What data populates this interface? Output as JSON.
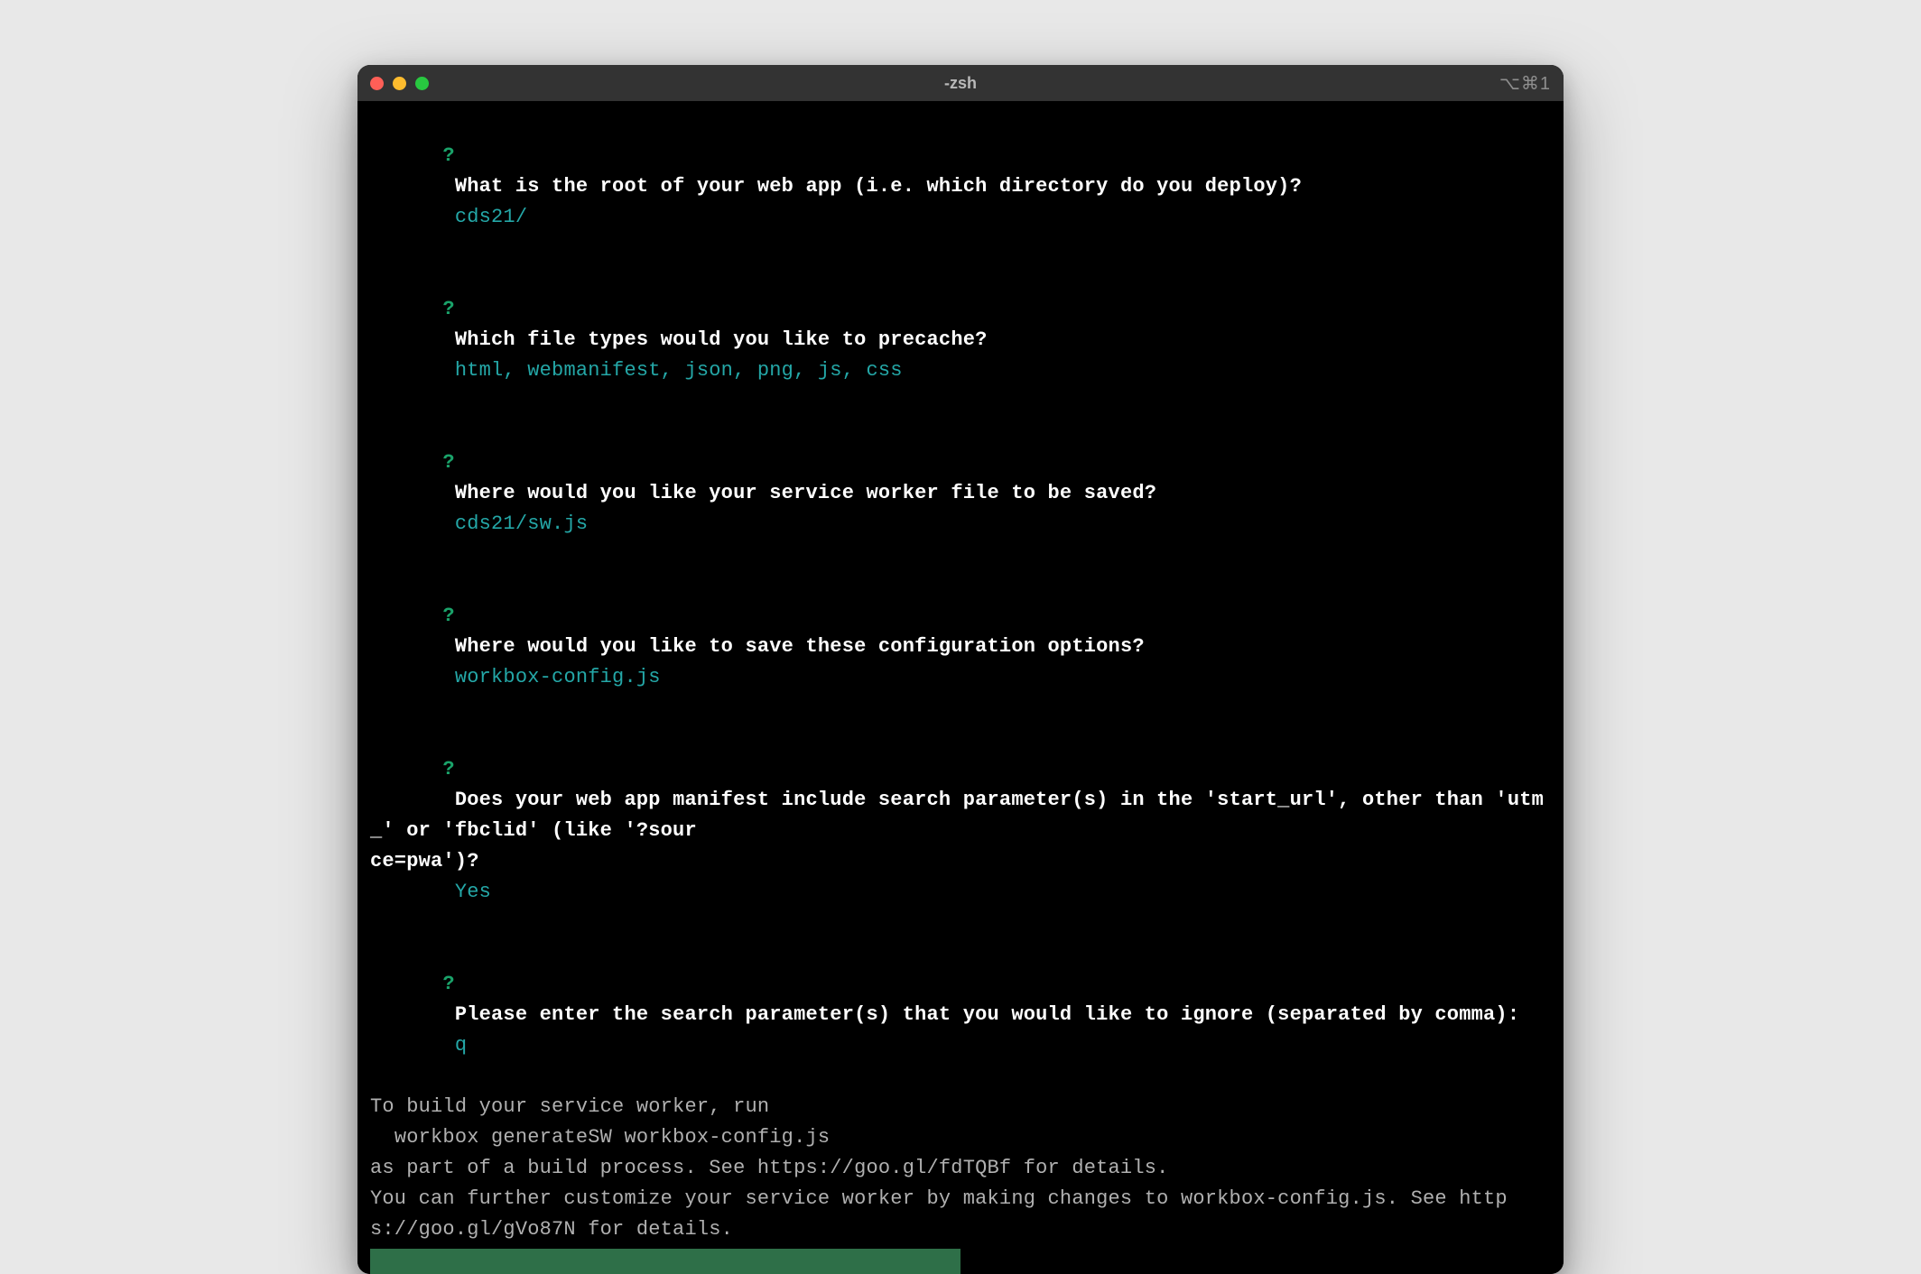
{
  "window": {
    "title": "-zsh",
    "indicator": "⌥⌘1"
  },
  "prompts": [
    {
      "mark": "?",
      "question": "What is the root of your web app (i.e. which directory do you deploy)?",
      "answer": "cds21/"
    },
    {
      "mark": "?",
      "question": "Which file types would you like to precache?",
      "answer": "html, webmanifest, json, png, js, css"
    },
    {
      "mark": "?",
      "question": "Where would you like your service worker file to be saved?",
      "answer": "cds21/sw.js"
    },
    {
      "mark": "?",
      "question": "Where would you like to save these configuration options?",
      "answer": "workbox-config.js"
    },
    {
      "mark": "?",
      "question": "Does your web app manifest include search parameter(s) in the 'start_url', other than 'utm_' or 'fbclid' (like '?sour\nce=pwa')?",
      "answer": "Yes"
    },
    {
      "mark": "?",
      "question": "Please enter the search parameter(s) that you would like to ignore (separated by comma):",
      "answer": "q"
    }
  ],
  "output": [
    "To build your service worker, run",
    "",
    "  workbox generateSW workbox-config.js",
    "",
    "as part of a build process. See https://goo.gl/fdTQBf for details.",
    "You can further customize your service worker by making changes to workbox-config.js. See https://goo.gl/gVo87N for details."
  ]
}
